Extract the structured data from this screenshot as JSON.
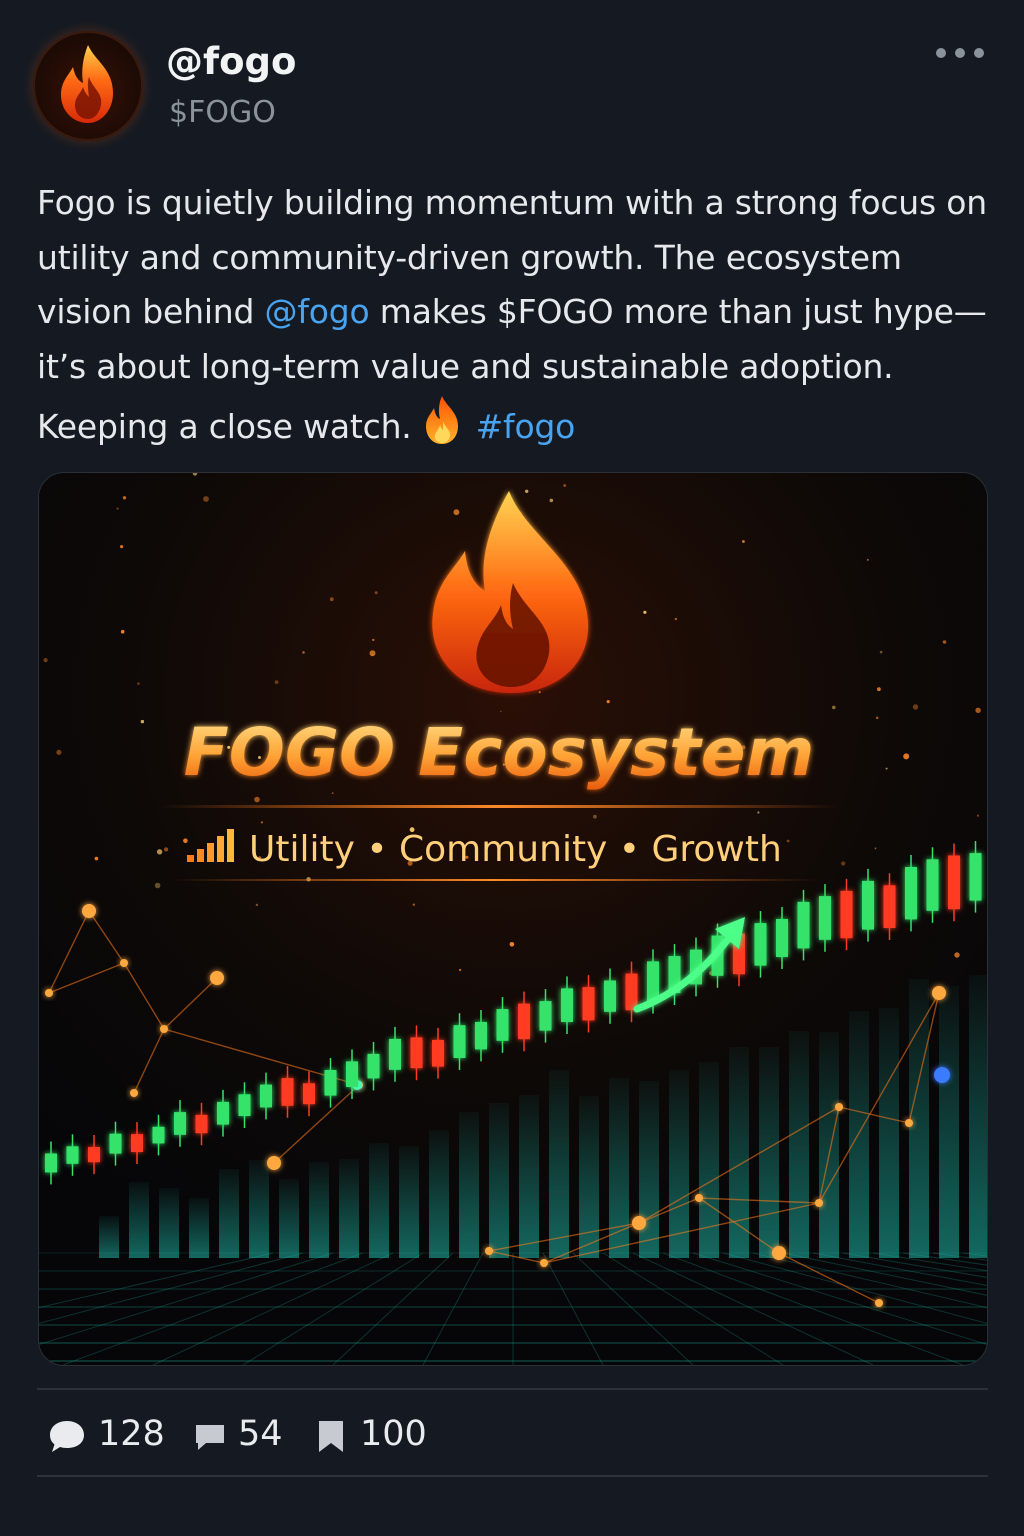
{
  "post": {
    "username": "@fogo",
    "handle": "$FOGO",
    "text_part1": "Fogo is quietly building momentum with a strong focus on utility and community-driven growth. The ecosystem vision behind ",
    "mention": "@fogo",
    "text_part2": " makes $FOGO more than just hype—it’s about long-term value and sustainable adoption. Keeping a close watch.",
    "hashtag": "#fogo"
  },
  "media": {
    "title": "FOGO Ecosystem",
    "subtitle": "Utility • Community • Growth"
  },
  "actions": {
    "comments": "128",
    "reposts": "54",
    "bookmarks": "100"
  },
  "icons": {
    "more": "more-horizontal-icon",
    "comment": "speech-bubble-icon",
    "repost": "message-square-icon",
    "bookmark": "bookmark-icon"
  },
  "colors": {
    "background": "#151a22",
    "link": "#4aa3ee",
    "accent": "#ff7a1a"
  }
}
